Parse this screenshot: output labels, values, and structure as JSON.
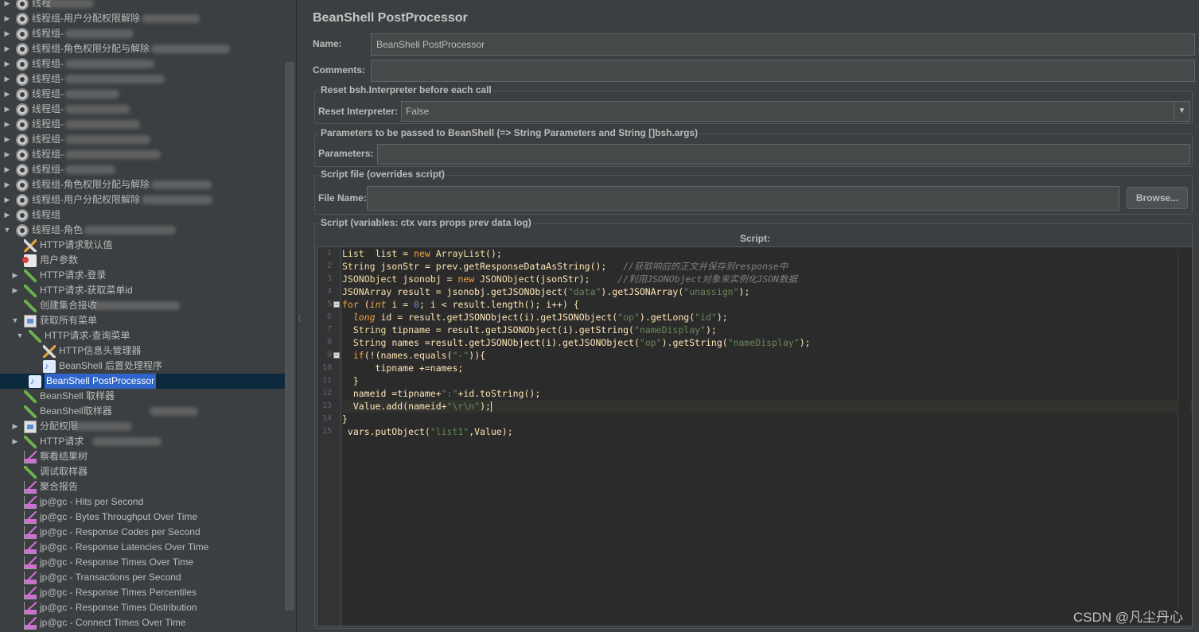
{
  "tree": {
    "items": [
      {
        "label": "线程",
        "expand": "▶",
        "icon": "gear",
        "blur": true
      },
      {
        "label": "线程组-用户分配权限解除",
        "expand": "▶",
        "icon": "gear",
        "blur": true
      },
      {
        "label": "线程组-",
        "expand": "▶",
        "icon": "gear",
        "blur": true
      },
      {
        "label": "线程组-角色权限分配与解除",
        "expand": "▶",
        "icon": "gear",
        "blur": true
      },
      {
        "label": "线程组-",
        "expand": "▶",
        "icon": "gear",
        "blur": true
      },
      {
        "label": "线程组-",
        "expand": "▶",
        "icon": "gear",
        "blur": true
      },
      {
        "label": "线程组-",
        "expand": "▶",
        "icon": "gear",
        "blur": true
      },
      {
        "label": "线程组-",
        "expand": "▶",
        "icon": "gear",
        "blur": true
      },
      {
        "label": "线程组-",
        "expand": "▶",
        "icon": "gear",
        "blur": true
      },
      {
        "label": "线程组-",
        "expand": "▶",
        "icon": "gear",
        "blur": true
      },
      {
        "label": "线程组-",
        "expand": "▶",
        "icon": "gear",
        "blur": true
      },
      {
        "label": "线程组-",
        "expand": "▶",
        "icon": "gear",
        "blur": true
      },
      {
        "label": "线程组-角色权限分配与解除",
        "expand": "▶",
        "icon": "gear",
        "blur": true
      },
      {
        "label": "线程组-用户分配权限解除",
        "expand": "▶",
        "icon": "gear",
        "blur": true
      },
      {
        "label": "线程组",
        "expand": "▶",
        "icon": "gear",
        "blur": false
      },
      {
        "label": "线程组-角色",
        "expand": "▼",
        "icon": "gear",
        "blur": true
      },
      {
        "label": "HTTP请求默认值",
        "expand": "",
        "icon": "wrench",
        "indent": 1
      },
      {
        "label": "用户参数",
        "expand": "",
        "icon": "doc-red",
        "indent": 1
      },
      {
        "label": "HTTP请求-登录",
        "expand": "▶",
        "icon": "pipette",
        "indent": 1
      },
      {
        "label": "HTTP请求-获取菜单id",
        "expand": "▶",
        "icon": "pipette",
        "indent": 1
      },
      {
        "label": "创建集合接收",
        "expand": "",
        "icon": "pipette",
        "indent": 1,
        "blur": true
      },
      {
        "label": "获取所有菜单",
        "expand": "▼",
        "icon": "folder",
        "indent": 1
      },
      {
        "label": "HTTP请求-查询菜单",
        "expand": "▼",
        "icon": "pipette",
        "indent": 2
      },
      {
        "label": "HTTP信息头管理器",
        "expand": "",
        "icon": "wrench",
        "indent": 3
      },
      {
        "label": "BeanShell 后置处理程序",
        "expand": "",
        "icon": "doc-blue",
        "indent": 3
      },
      {
        "label": "BeanShell PostProcessor",
        "expand": "",
        "icon": "doc-blue",
        "indent": 2,
        "selected": true
      },
      {
        "label": "BeanShell 取样器",
        "expand": "",
        "icon": "pipette",
        "indent": 1
      },
      {
        "label": "BeanShell取样器",
        "expand": "",
        "icon": "pipette",
        "indent": 1,
        "blur": true
      },
      {
        "label": "分配权限",
        "expand": "▶",
        "icon": "folder",
        "indent": 1,
        "blur": true
      },
      {
        "label": "HTTP请求",
        "expand": "▶",
        "icon": "pipette",
        "indent": 1,
        "blur": true
      },
      {
        "label": "察看结果树",
        "expand": "",
        "icon": "graph",
        "indent": 1
      },
      {
        "label": "调试取样器",
        "expand": "",
        "icon": "pipette",
        "indent": 1
      },
      {
        "label": "聚合报告",
        "expand": "",
        "icon": "graph",
        "indent": 1
      },
      {
        "label": "jp@gc - Hits per Second",
        "expand": "",
        "icon": "graph",
        "indent": 1
      },
      {
        "label": "jp@gc - Bytes Throughput Over Time",
        "expand": "",
        "icon": "graph",
        "indent": 1
      },
      {
        "label": "jp@gc - Response Codes per Second",
        "expand": "",
        "icon": "graph",
        "indent": 1
      },
      {
        "label": "jp@gc - Response Latencies Over Time",
        "expand": "",
        "icon": "graph",
        "indent": 1
      },
      {
        "label": "jp@gc - Response Times Over Time",
        "expand": "",
        "icon": "graph",
        "indent": 1
      },
      {
        "label": "jp@gc - Transactions per Second",
        "expand": "",
        "icon": "graph",
        "indent": 1
      },
      {
        "label": "jp@gc - Response Times Percentiles",
        "expand": "",
        "icon": "graph",
        "indent": 1
      },
      {
        "label": "jp@gc - Response Times Distribution",
        "expand": "",
        "icon": "graph",
        "indent": 1
      },
      {
        "label": "jp@gc - Connect Times Over Time",
        "expand": "",
        "icon": "graph",
        "indent": 1
      }
    ]
  },
  "panel": {
    "title": "BeanShell PostProcessor",
    "name_label": "Name:",
    "name_value": "BeanShell PostProcessor",
    "comments_label": "Comments:",
    "comments_value": "",
    "reset_group_title": "Reset bsh.Interpreter before each call",
    "reset_label": "Reset Interpreter:",
    "reset_value": "False",
    "params_group_title": "Parameters to be passed to BeanShell (=> String Parameters and String []bsh.args)",
    "params_label": "Parameters:",
    "params_value": "",
    "file_group_title": "Script file (overrides script)",
    "file_label": "File Name:",
    "file_value": "",
    "browse_label": "Browse...",
    "script_group_title": "Script (variables: ctx vars props prev data log)",
    "script_label": "Script:"
  },
  "code": {
    "line_numbers": [
      "1",
      "2",
      "3",
      "4",
      "5",
      "6",
      "7",
      "8",
      "9",
      "10",
      "11",
      "12",
      "13",
      "14",
      "15"
    ],
    "lines": [
      [
        [
          "ty",
          "List"
        ],
        [
          "",
          "  list = "
        ],
        [
          "kw",
          "new"
        ],
        [
          "",
          ""
        ],
        [
          "ty",
          " ArrayList"
        ],
        [
          "",
          "();"
        ]
      ],
      [
        [
          "ty",
          "String"
        ],
        [
          "",
          " jsonStr = prev.getResponseDataAsString();   "
        ],
        [
          "cm",
          "//获取响应的正文并保存到response中"
        ]
      ],
      [
        [
          "ty",
          "JSONObject"
        ],
        [
          "",
          " jsonobj = "
        ],
        [
          "kw",
          "new"
        ],
        [
          "ty",
          " JSONObject"
        ],
        [
          "",
          "(jsonStr);     "
        ],
        [
          "cm",
          "//利用JSONObject对象来实例化JSON数据"
        ]
      ],
      [
        [
          "ty",
          "JSONArray"
        ],
        [
          "",
          " result = jsonobj.getJSONObject("
        ],
        [
          "str",
          "\"data\""
        ],
        [
          "",
          ").getJSONArray("
        ],
        [
          "str",
          "\"unassign\""
        ],
        [
          "",
          ");"
        ]
      ],
      [
        [
          "kw",
          "for"
        ],
        [
          "",
          " ("
        ],
        [
          "kw it",
          "int"
        ],
        [
          "",
          " i = "
        ],
        [
          "num",
          "0"
        ],
        [
          "",
          "; i < result.length(); i++) {"
        ]
      ],
      [
        [
          "",
          "  "
        ],
        [
          "kw it",
          "long"
        ],
        [
          "",
          " id = result.getJSONObject(i).getJSONObject("
        ],
        [
          "str",
          "\"op\""
        ],
        [
          "",
          ").getLong("
        ],
        [
          "str",
          "\"id\""
        ],
        [
          "",
          ");"
        ]
      ],
      [
        [
          "",
          "  "
        ],
        [
          "ty",
          "String"
        ],
        [
          "",
          " tipname = result.getJSONObject(i).getString("
        ],
        [
          "str",
          "\"nameDisplay\""
        ],
        [
          "",
          ");"
        ]
      ],
      [
        [
          "",
          "  "
        ],
        [
          "ty",
          "String"
        ],
        [
          "",
          " names =result.getJSONObject(i).getJSONObject("
        ],
        [
          "str",
          "\"op\""
        ],
        [
          "",
          ").getString("
        ],
        [
          "str",
          "\"nameDisplay\""
        ],
        [
          "",
          ");"
        ]
      ],
      [
        [
          "",
          "  "
        ],
        [
          "kw",
          "if"
        ],
        [
          "",
          "(!(names.equals("
        ],
        [
          "str",
          "\"-\""
        ],
        [
          "",
          ")){"
        ]
      ],
      [
        [
          "",
          "      tipname +=names;"
        ]
      ],
      [
        [
          "",
          "  }"
        ]
      ],
      [
        [
          "",
          "  nameid =tipname+"
        ],
        [
          "str",
          "\":\""
        ],
        [
          "",
          "+id.toString();"
        ]
      ],
      [
        [
          "",
          "  Value.add(nameid+"
        ],
        [
          "str",
          "\"\\r\\n\""
        ],
        [
          "",
          ");"
        ],
        [
          "caret",
          ""
        ]
      ],
      [
        [
          "",
          "}"
        ]
      ],
      [
        [
          "",
          " vars.putObject("
        ],
        [
          "str",
          "\"list1\""
        ],
        [
          "",
          ",Value);"
        ]
      ]
    ],
    "current_line": 13,
    "fold_lines": [
      5,
      9
    ]
  },
  "watermark": "CSDN @凡尘丹心"
}
